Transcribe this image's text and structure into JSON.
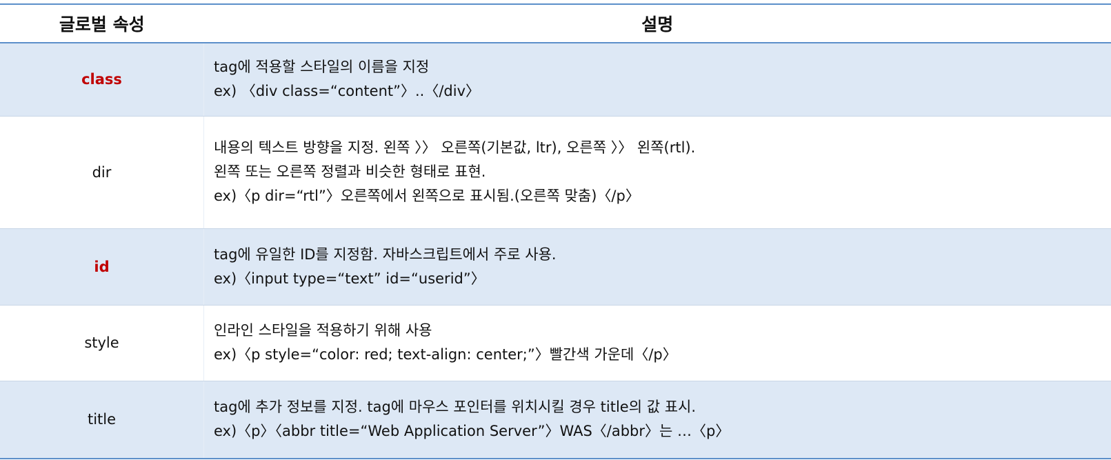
{
  "header": {
    "col1": "글로벌 속성",
    "col2": "설명"
  },
  "rows": [
    {
      "attr": "class",
      "highlight": true,
      "shaded": true,
      "lines": [
        "tag에 적용할 스타일의 이름을 지정",
        "ex) 〈div class=“content”〉..〈/div〉"
      ]
    },
    {
      "attr": "dir",
      "highlight": false,
      "shaded": false,
      "lines": [
        "내용의 텍스트 방향을 지정. 왼쪽 〉〉 오른쪽(기본값, ltr), 오른쪽 〉〉 왼쪽(rtl).",
        "왼쪽 또는 오른쪽 정렬과 비슷한 형태로 표현.",
        "ex)〈p dir=“rtl”〉오른쪽에서 왼쪽으로 표시됨.(오른쪽 맞춤)〈/p〉"
      ]
    },
    {
      "attr": "id",
      "highlight": true,
      "shaded": true,
      "lines": [
        "tag에 유일한 ID를 지정함. 자바스크립트에서 주로 사용.",
        "ex)〈input type=“text” id=“userid”〉"
      ]
    },
    {
      "attr": "style",
      "highlight": false,
      "shaded": false,
      "lines": [
        "인라인 스타일을 적용하기 위해 사용",
        "ex)〈p style=“color: red; text-align: center;”〉빨간색 가운데〈/p〉"
      ]
    },
    {
      "attr": "title",
      "highlight": false,
      "shaded": true,
      "lines": [
        "tag에 추가 정보를 지정. tag에 마우스 포인터를 위치시킬 경우 title의 값 표시.",
        "ex)〈p〉〈abbr title=“Web Application Server”〉WAS〈/abbr〉는 …〈p〉"
      ]
    }
  ],
  "colors": {
    "accent_border": "#5b8fc9",
    "shade": "#dde8f5",
    "highlight_text": "#c00000"
  }
}
